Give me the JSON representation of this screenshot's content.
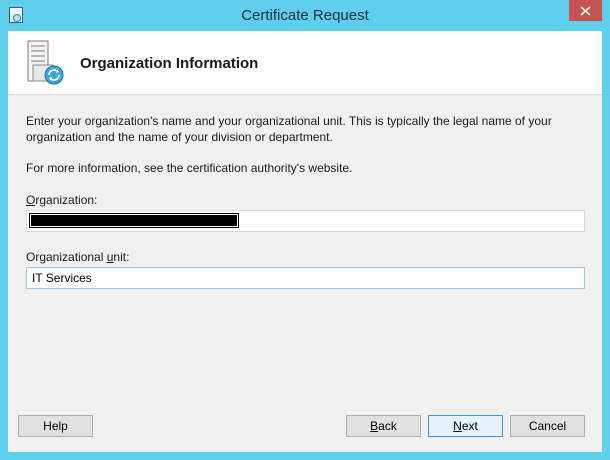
{
  "window": {
    "title": "Certificate Request",
    "accent_color": "#5fcfee",
    "close_color": "#c75050"
  },
  "header": {
    "title": "Organization Information"
  },
  "body": {
    "description": "Enter your organization's name and your organizational unit. This is typically the legal name of your organization and the name of your division or department.",
    "more_info": "For more information, see the certification authority's website."
  },
  "form": {
    "organization": {
      "label_pre": "",
      "label_accel": "O",
      "label_post": "rganization:",
      "value": ""
    },
    "organizational_unit": {
      "label_pre": "Organizational ",
      "label_accel": "u",
      "label_post": "nit:",
      "value": "IT Services"
    }
  },
  "buttons": {
    "help": "Help",
    "back_pre": "",
    "back_accel": "B",
    "back_post": "ack",
    "next_pre": "",
    "next_accel": "N",
    "next_post": "ext",
    "cancel": "Cancel"
  },
  "icons": {
    "app": "certificate-app-icon",
    "close": "close-icon",
    "wizard": "server-certificate-icon"
  }
}
